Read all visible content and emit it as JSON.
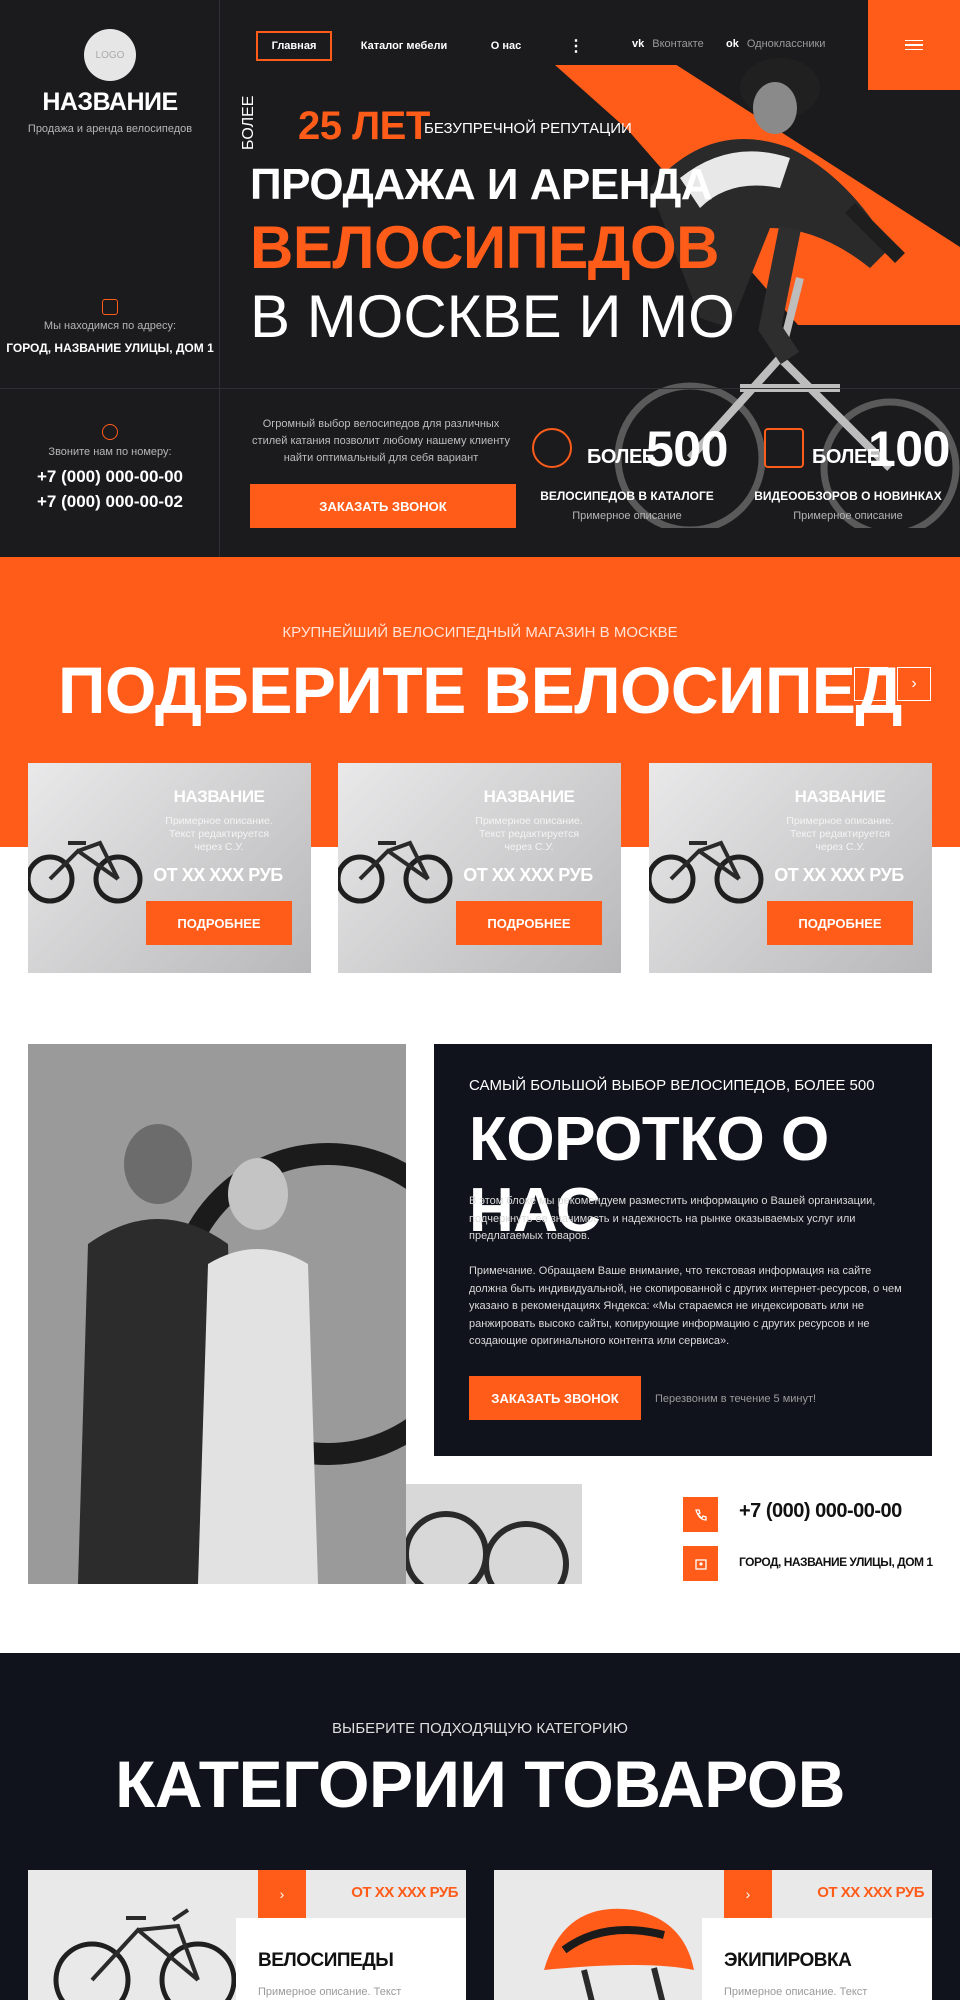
{
  "brand": {
    "logo_text": "LOGO",
    "name": "НАЗВАНИЕ",
    "subtitle": "Продажа и аренда велосипедов"
  },
  "sidebar": {
    "address_label": "Мы находимся по адресу:",
    "address": "ГОРОД, НАЗВАНИЕ УЛИЦЫ, ДОМ 1",
    "phone_label": "Звоните нам по номеру:",
    "phone1": "+7 (000) 000-00-00",
    "phone2": "+7 (000) 000-00-02"
  },
  "nav": {
    "items": [
      "Главная",
      "Каталог мебели",
      "О нас"
    ],
    "more": "⋮",
    "social": [
      {
        "icon": "vk-icon",
        "glyph": "vk",
        "label": "Вконтакте"
      },
      {
        "icon": "ok-icon",
        "glyph": "ok",
        "label": "Одноклассники"
      }
    ]
  },
  "hero": {
    "since": "БОЛЕЕ",
    "years": "25 ЛЕТ",
    "years_sub": "БЕЗУПРЕЧНОЙ РЕПУТАЦИИ",
    "line1": "ПРОДАЖА И АРЕНДА",
    "line2": "ВЕЛОСИПЕДОВ",
    "line3": "В МОСКВЕ И МО",
    "description": "Огромный выбор велосипедов для различных стилей катания позволит любому нашему клиенту найти оптимальный для себя вариант",
    "cta": "ЗАКАЗАТЬ ЗВОНОК",
    "stats": [
      {
        "pre": "БОЛЕЕ",
        "num": "500",
        "title": "ВЕЛОСИПЕДОВ В КАТАЛОГЕ",
        "desc": "Примерное описание",
        "icon": "bike-icon"
      },
      {
        "pre": "БОЛЕЕ",
        "num": "100",
        "title": "ВИДЕООБЗОРОВ О НОВИНКАХ",
        "desc": "Примерное описание",
        "icon": "video-icon"
      }
    ]
  },
  "pick": {
    "pre": "КРУПНЕЙШИЙ ВЕЛОСИПЕДНЫЙ МАГАЗИН В МОСКВЕ",
    "title": "ПОДБЕРИТЕ ВЕЛОСИПЕД",
    "prev": "‹",
    "next": "›",
    "cards": [
      {
        "name": "НАЗВАНИЕ",
        "desc": "Примерное описание. Текст редактируется через С.У.",
        "price": "ОТ ХХ ХХХ РУБ",
        "button": "ПОДРОБНЕЕ"
      },
      {
        "name": "НАЗВАНИЕ",
        "desc": "Примерное описание. Текст редактируется через С.У.",
        "price": "ОТ ХХ ХХХ РУБ",
        "button": "ПОДРОБНЕЕ"
      },
      {
        "name": "НАЗВАНИЕ",
        "desc": "Примерное описание. Текст редактируется через С.У.",
        "price": "ОТ ХХ ХХХ РУБ",
        "button": "ПОДРОБНЕЕ"
      }
    ]
  },
  "about": {
    "pre": "САМЫЙ БОЛЬШОЙ ВЫБОР ВЕЛОСИПЕДОВ, БОЛЕЕ 500",
    "title": "КОРОТКО О НАС",
    "p1": "В этом блоке мы рекомендуем разместить информацию о Вашей организации, подчеркнуть ее значимость и надежность на рынке оказываемых услуг или предлагаемых товаров.",
    "p2": "Примечание. Обращаем Ваше внимание, что текстовая информация на сайте должна быть индивидуальной, не скопированной с других интернет-ресурсов, о чем указано в рекомендациях Яндекса: «Мы стараемся не индексировать или не ранжировать высоко сайты, копирующие информацию с других ресурсов и не создающие оригинального контента или сервиса».",
    "cta": "ЗАКАЗАТЬ ЗВОНОК",
    "note": "Перезвоним в течение 5 минут!",
    "phone": "+7 (000) 000-00-00",
    "address": "ГОРОД, НАЗВАНИЕ УЛИЦЫ, ДОМ 1"
  },
  "categories": {
    "pre": "ВЫБЕРИТЕ ПОДХОДЯЩУЮ КАТЕГОРИЮ",
    "title": "КАТЕГОРИИ ТОВАРОВ",
    "items": [
      {
        "name": "ВЕЛОСИПЕДЫ",
        "price": "ОТ ХХ ХХХ РУБ",
        "desc": "Примерное описание. Текст",
        "arrow": "›"
      },
      {
        "name": "ЭКИПИРОВКА",
        "price": "ОТ ХХ ХХХ РУБ",
        "desc": "Примерное описание. Текст",
        "arrow": "›"
      }
    ]
  },
  "colors": {
    "accent": "#ff5c1a",
    "dark": "#1b1b1d",
    "navy": "#10131c"
  }
}
